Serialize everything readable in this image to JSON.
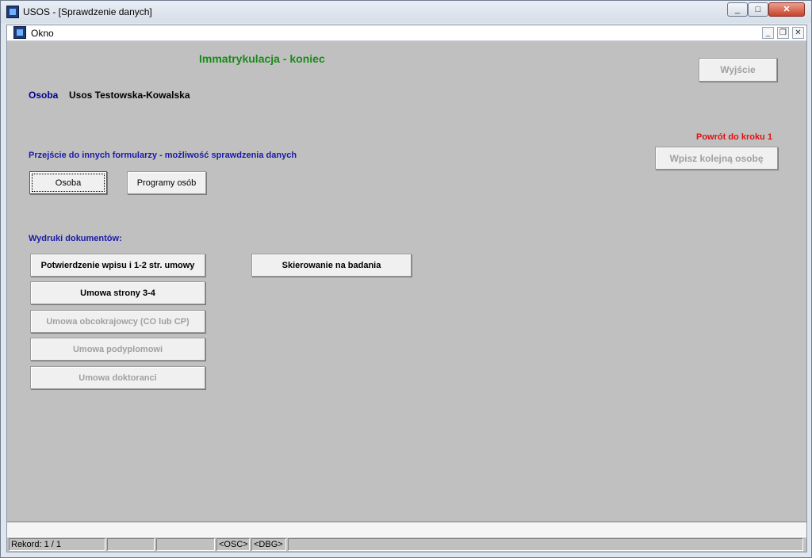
{
  "window": {
    "title": "USOS - [Sprawdzenie danych]",
    "controls": {
      "minimize": "_",
      "maximize": "□",
      "close": "✕"
    }
  },
  "child_window": {
    "title": "Okno",
    "controls": {
      "minimize": "_",
      "restore": "❐",
      "close": "✕"
    }
  },
  "form": {
    "title": "Immatrykulacja - koniec",
    "person_label": "Osoba",
    "person_value": "Usos Testowska-Kowalska",
    "exit_button": "Wyjście",
    "return_label": "Powrót do kroku 1",
    "next_person_button": "Wpisz kolejną osobę",
    "section_forms_label": "Przejście do innych formularzy - możliwość sprawdzenia danych",
    "osoba_button": "Osoba",
    "programy_button": "Programy osób",
    "section_prints_label": "Wydruki dokumentów:",
    "print_buttons": {
      "potwierdzenie": "Potwierdzenie wpisu i 1-2 str. umowy",
      "skierowanie": "Skierowanie na badania",
      "umowa34": "Umowa strony 3-4",
      "obcokrajowcy": "Umowa obcokrajowcy (CO lub CP)",
      "podyplomowi": "Umowa podyplomowi",
      "doktoranci": "Umowa doktoranci"
    }
  },
  "status": {
    "message": "",
    "record": "Rekord: 1 / 1",
    "osc": "<OSC>",
    "dbg": "<DBG>"
  }
}
